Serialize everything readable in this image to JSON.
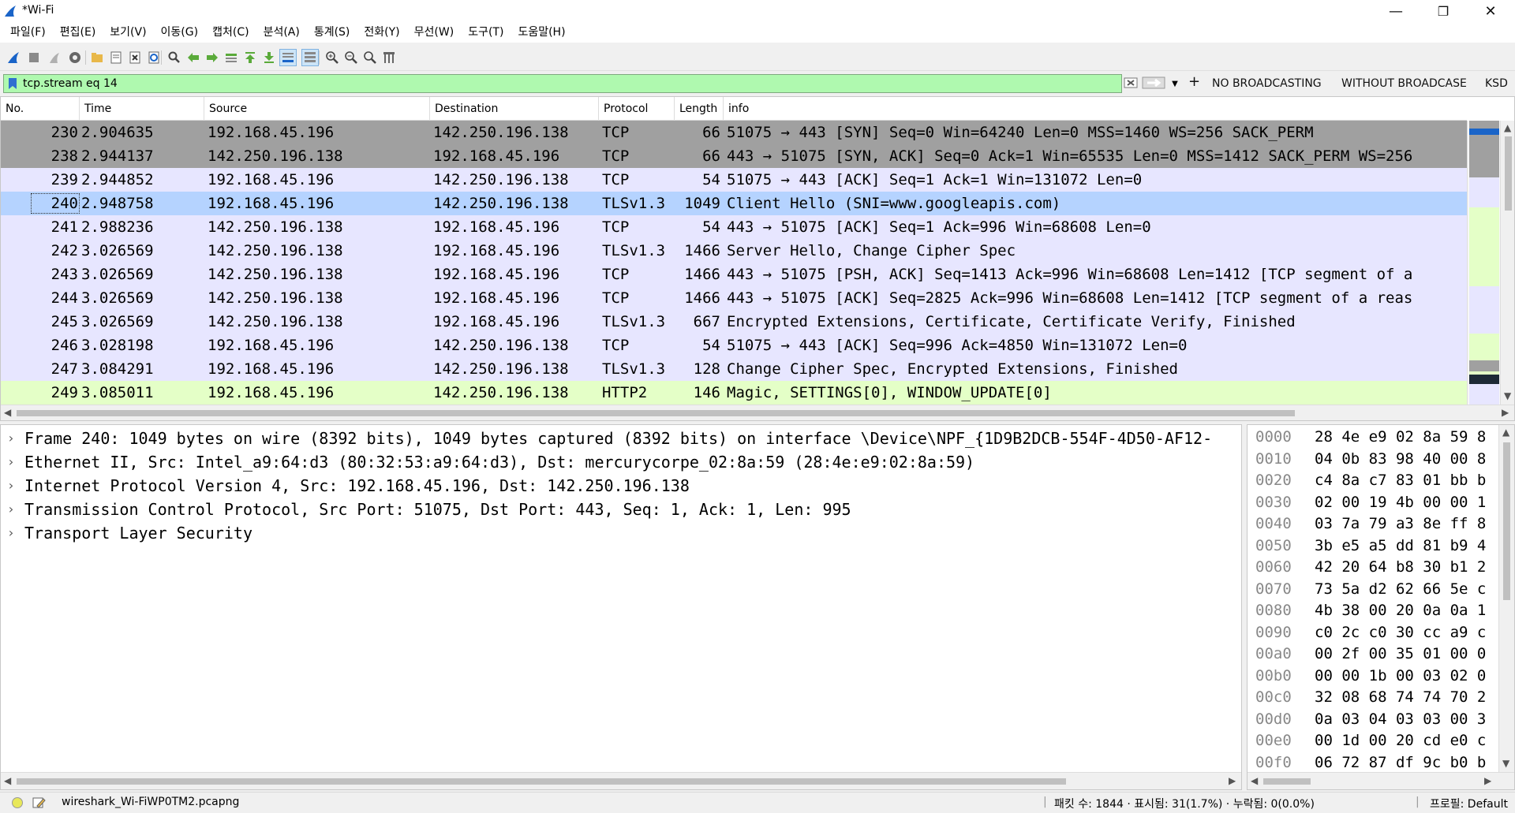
{
  "window": {
    "title": "*Wi-Fi"
  },
  "menu": [
    "파일(F)",
    "편집(E)",
    "보기(V)",
    "이동(G)",
    "캡처(C)",
    "분석(A)",
    "통계(S)",
    "전화(Y)",
    "무선(W)",
    "도구(T)",
    "도움말(H)"
  ],
  "filter": {
    "value": "tcp.stream eq 14",
    "buttons": [
      "NO BROADCASTING",
      "WITHOUT BROADCASE",
      "KSD"
    ],
    "add_label": "+"
  },
  "packet_list": {
    "columns": [
      "No.",
      "Time",
      "Source",
      "Destination",
      "Protocol",
      "Length",
      "info"
    ],
    "rows": [
      {
        "no": "230",
        "time": "2.904635",
        "src": "192.168.45.196",
        "dst": "142.250.196.138",
        "proto": "TCP",
        "len": "66",
        "info": "51075 → 443 [SYN] Seq=0 Win=64240 Len=0 MSS=1460 WS=256 SACK_PERM"
      },
      {
        "no": "238",
        "time": "2.944137",
        "src": "142.250.196.138",
        "dst": "192.168.45.196",
        "proto": "TCP",
        "len": "66",
        "info": "443 → 51075 [SYN, ACK] Seq=0 Ack=1 Win=65535 Len=0 MSS=1412 SACK_PERM WS=256"
      },
      {
        "no": "239",
        "time": "2.944852",
        "src": "192.168.45.196",
        "dst": "142.250.196.138",
        "proto": "TCP",
        "len": "54",
        "info": "51075 → 443 [ACK] Seq=1 Ack=1 Win=131072 Len=0"
      },
      {
        "no": "240",
        "time": "2.948758",
        "src": "192.168.45.196",
        "dst": "142.250.196.138",
        "proto": "TLSv1.3",
        "len": "1049",
        "info": "Client Hello (SNI=www.googleapis.com)"
      },
      {
        "no": "241",
        "time": "2.988236",
        "src": "142.250.196.138",
        "dst": "192.168.45.196",
        "proto": "TCP",
        "len": "54",
        "info": "443 → 51075 [ACK] Seq=1 Ack=996 Win=68608 Len=0"
      },
      {
        "no": "242",
        "time": "3.026569",
        "src": "142.250.196.138",
        "dst": "192.168.45.196",
        "proto": "TLSv1.3",
        "len": "1466",
        "info": "Server Hello, Change Cipher Spec"
      },
      {
        "no": "243",
        "time": "3.026569",
        "src": "142.250.196.138",
        "dst": "192.168.45.196",
        "proto": "TCP",
        "len": "1466",
        "info": "443 → 51075 [PSH, ACK] Seq=1413 Ack=996 Win=68608 Len=1412 [TCP segment of a"
      },
      {
        "no": "244",
        "time": "3.026569",
        "src": "142.250.196.138",
        "dst": "192.168.45.196",
        "proto": "TCP",
        "len": "1466",
        "info": "443 → 51075 [ACK] Seq=2825 Ack=996 Win=68608 Len=1412 [TCP segment of a reas"
      },
      {
        "no": "245",
        "time": "3.026569",
        "src": "142.250.196.138",
        "dst": "192.168.45.196",
        "proto": "TLSv1.3",
        "len": "667",
        "info": "Encrypted Extensions, Certificate, Certificate Verify, Finished"
      },
      {
        "no": "246",
        "time": "3.028198",
        "src": "192.168.45.196",
        "dst": "142.250.196.138",
        "proto": "TCP",
        "len": "54",
        "info": "51075 → 443 [ACK] Seq=996 Ack=4850 Win=131072 Len=0"
      },
      {
        "no": "247",
        "time": "3.084291",
        "src": "192.168.45.196",
        "dst": "142.250.196.138",
        "proto": "TLSv1.3",
        "len": "128",
        "info": "Change Cipher Spec, Encrypted Extensions, Finished"
      },
      {
        "no": "249",
        "time": "3.085011",
        "src": "192.168.45.196",
        "dst": "142.250.196.138",
        "proto": "HTTP2",
        "len": "146",
        "info": "Magic, SETTINGS[0], WINDOW_UPDATE[0]"
      }
    ],
    "row_colors": [
      "#a0a0a0",
      "#a0a0a0",
      "#e7e6ff",
      "#b5d3ff",
      "#e7e6ff",
      "#e7e6ff",
      "#e7e6ff",
      "#e7e6ff",
      "#e7e6ff",
      "#e7e6ff",
      "#e7e6ff",
      "#e4ffc7"
    ]
  },
  "details": [
    "Frame 240: 1049 bytes on wire (8392 bits), 1049 bytes captured (8392 bits) on interface \\Device\\NPF_{1D9B2DCB-554F-4D50-AF12-",
    "Ethernet II, Src: Intel_a9:64:d3 (80:32:53:a9:64:d3), Dst: mercurycorpe_02:8a:59 (28:4e:e9:02:8a:59)",
    "Internet Protocol Version 4, Src: 192.168.45.196, Dst: 142.250.196.138",
    "Transmission Control Protocol, Src Port: 51075, Dst Port: 443, Seq: 1, Ack: 1, Len: 995",
    "Transport Layer Security"
  ],
  "bytes": [
    {
      "offset": "0000",
      "hex": "28 4e e9 02 8a 59 8"
    },
    {
      "offset": "0010",
      "hex": "04 0b 83 98 40 00 8"
    },
    {
      "offset": "0020",
      "hex": "c4 8a c7 83 01 bb b"
    },
    {
      "offset": "0030",
      "hex": "02 00 19 4b 00 00 1"
    },
    {
      "offset": "0040",
      "hex": "03 7a 79 a3 8e ff 8"
    },
    {
      "offset": "0050",
      "hex": "3b e5 a5 dd 81 b9 4"
    },
    {
      "offset": "0060",
      "hex": "42 20 64 b8 30 b1 2"
    },
    {
      "offset": "0070",
      "hex": "73 5a d2 62 66 5e c"
    },
    {
      "offset": "0080",
      "hex": "4b 38 00 20 0a 0a 1"
    },
    {
      "offset": "0090",
      "hex": "c0 2c c0 30 cc a9 c"
    },
    {
      "offset": "00a0",
      "hex": "00 2f 00 35 01 00 0"
    },
    {
      "offset": "00b0",
      "hex": "00 00 1b 00 03 02 0"
    },
    {
      "offset": "00c0",
      "hex": "32 08 68 74 74 70 2"
    },
    {
      "offset": "00d0",
      "hex": "0a 03 04 03 03 00 3"
    },
    {
      "offset": "00e0",
      "hex": "00 1d 00 20 cd e0 c"
    },
    {
      "offset": "00f0",
      "hex": "06 72 87 df 9c b0 b"
    }
  ],
  "status": {
    "file": "wireshark_Wi-FiWP0TM2.pcapng",
    "counts": "패킷 수: 1844 · 표시됨: 31(1.7%) · 누락됨: 0(0.0%)",
    "profile": "프로필: Default"
  },
  "colors": {
    "filter_valid": "#aff9af",
    "selected_row": "#b5d3ff",
    "wireshark_blue": "#1a64c8"
  }
}
